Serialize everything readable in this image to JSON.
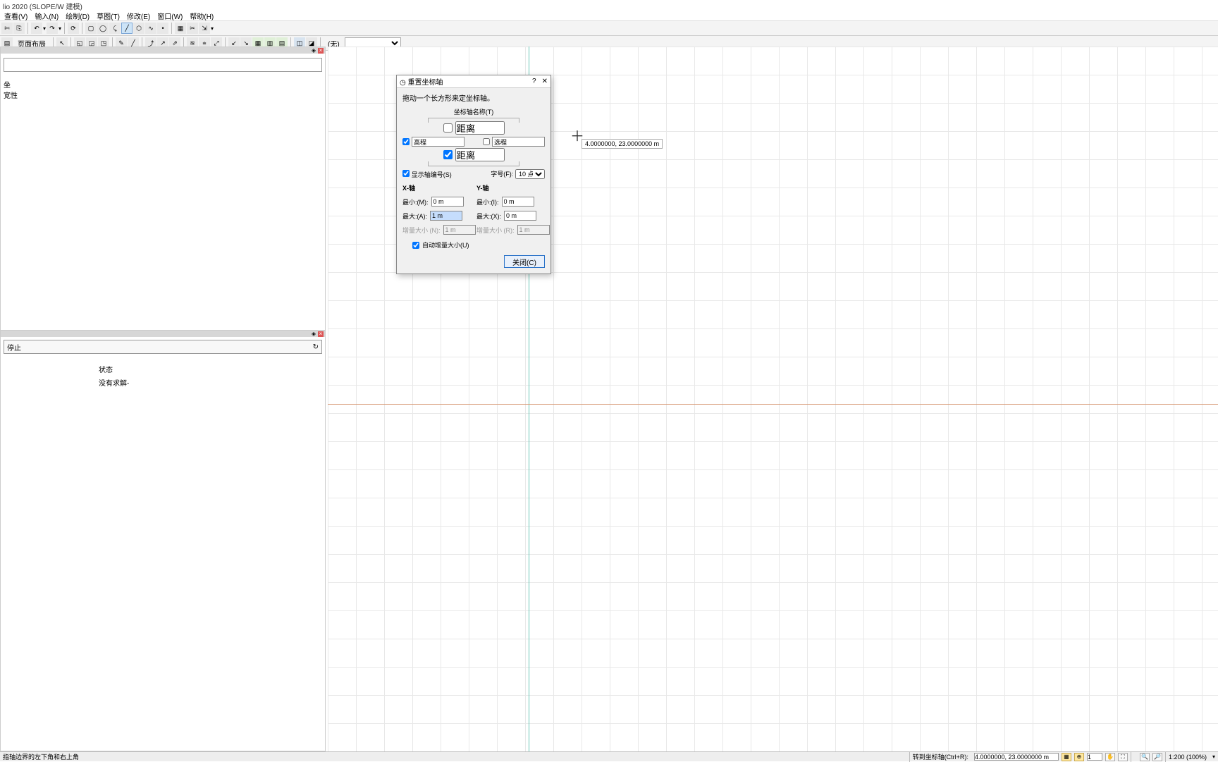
{
  "titlebar": "lio 2020 (SLOPE/W 建模)",
  "menu": {
    "m1": "查看(V)",
    "m2": "输入(N)",
    "m3": "绘制(D)",
    "m4": "草图(T)",
    "m5": "修改(E)",
    "m6": "窗口(W)",
    "m7": "帮助(H)"
  },
  "toolbar1": {
    "btn_layout": "页面布局",
    "dropdown_label": "(无)"
  },
  "left_panel": {
    "line1": "坐",
    "line2": "宽性"
  },
  "bottom_panel": {
    "search_hint": "停止",
    "refresh": "↻",
    "c1": "状态",
    "c2": "没有求解-"
  },
  "canvas": {
    "coord_tip": "4.0000000, 23.0000000 m"
  },
  "dialog": {
    "title": "重置坐标轴",
    "hint": "拖动一个长方形来定坐标轴。",
    "axis_name_label": "坐标轴名称(T)",
    "top_label": "距离",
    "left_chk_label": "高程",
    "right_chk_label": "选程",
    "bottom_label": "距离",
    "show_axis_chk": "显示轴编号(S)",
    "font_label": "字号(F):",
    "font_value": "10 点",
    "x_axis": {
      "header": "X-轴",
      "min_label": "最小:(M):",
      "min_val": "0 m",
      "max_label": "最大:(A):",
      "max_val": "1 m",
      "inc_label": "增量大小 (N):",
      "inc_val": "1 m"
    },
    "y_axis": {
      "header": "Y-轴",
      "min_label": "最小:(I):",
      "min_val": "0 m",
      "max_label": "最大:(X):",
      "max_val": "0 m",
      "inc_label": "增量大小 (R):",
      "inc_val": "1 m"
    },
    "auto_chk": "自动增量大小(U)",
    "close_btn": "关闭(C)"
  },
  "statusbar": {
    "left_msg": "指轴边界的左下角和右上角",
    "label_goto": "转到坐标轴(Ctrl+R):",
    "coord_val": "4.0000000, 23.0000000 m",
    "snap_val": "1",
    "zoom_label": "1:200 (100%)"
  }
}
